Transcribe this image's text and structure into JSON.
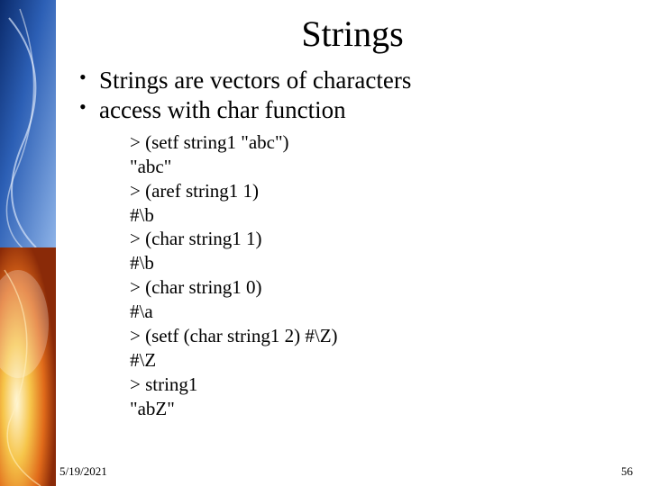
{
  "title": "Strings",
  "bullets": [
    "Strings are vectors of characters",
    "access with char function"
  ],
  "code_lines": [
    "> (setf string1 \"abc\")",
    "\"abc\"",
    "> (aref string1 1)",
    "#\\b",
    "> (char string1 1)",
    "#\\b",
    "> (char string1 0)",
    "#\\a",
    "> (setf (char string1 2) #\\Z)",
    "#\\Z",
    "> string1",
    "\"abZ\""
  ],
  "footer": {
    "date": "5/19/2021",
    "page": "56"
  }
}
